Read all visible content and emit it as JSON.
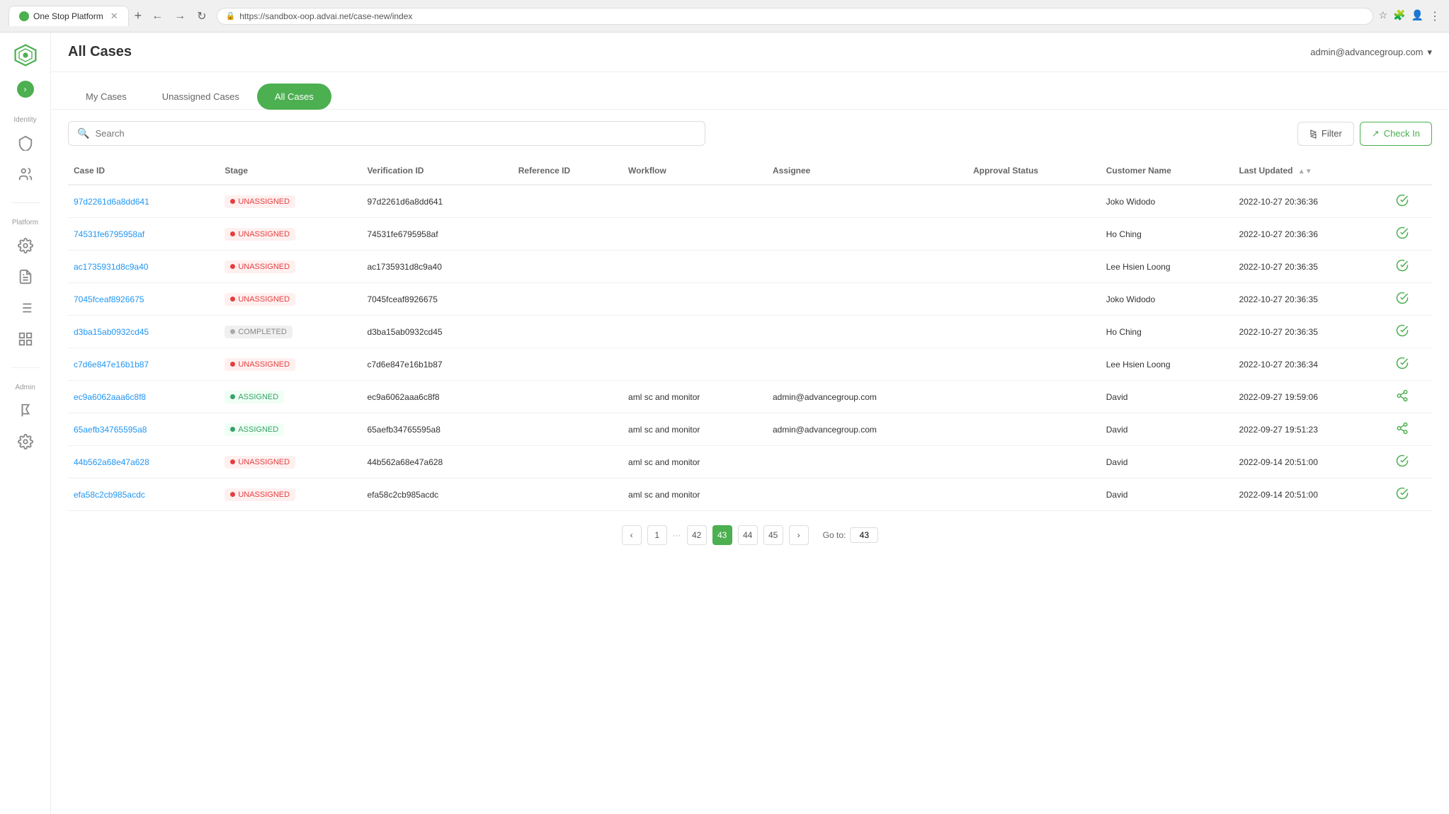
{
  "browser": {
    "tab_title": "One Stop Platform",
    "url": "sandbox-oop.advai.net/case-new/index",
    "url_full": "https://sandbox-oop.advai.net/case-new/index"
  },
  "header": {
    "title": "All Cases",
    "user": "admin@advancegroup.com",
    "user_chevron": "▾"
  },
  "tabs": [
    {
      "id": "my-cases",
      "label": "My Cases",
      "active": false
    },
    {
      "id": "unassigned-cases",
      "label": "Unassigned Cases",
      "active": false
    },
    {
      "id": "all-cases",
      "label": "All Cases",
      "active": true
    }
  ],
  "toolbar": {
    "search_placeholder": "Search",
    "filter_label": "Filter",
    "checkin_label": "Check In"
  },
  "table": {
    "columns": [
      {
        "id": "case-id",
        "label": "Case ID"
      },
      {
        "id": "stage",
        "label": "Stage"
      },
      {
        "id": "verification-id",
        "label": "Verification ID"
      },
      {
        "id": "reference-id",
        "label": "Reference ID"
      },
      {
        "id": "workflow",
        "label": "Workflow"
      },
      {
        "id": "assignee",
        "label": "Assignee"
      },
      {
        "id": "approval-status",
        "label": "Approval Status"
      },
      {
        "id": "customer-name",
        "label": "Customer Name"
      },
      {
        "id": "last-updated",
        "label": "Last Updated",
        "sortable": true
      }
    ],
    "rows": [
      {
        "case_id": "97d2261d6a8dd641",
        "stage": "UNASSIGNED",
        "stage_type": "unassigned",
        "verification_id": "97d2261d6a8dd641",
        "reference_id": "",
        "workflow": "",
        "assignee": "",
        "approval_status": "",
        "customer_name": "Joko Widodo",
        "last_updated": "2022-10-27 20:36:36",
        "icon": "check-circle"
      },
      {
        "case_id": "74531fe6795958af",
        "stage": "UNASSIGNED",
        "stage_type": "unassigned",
        "verification_id": "74531fe6795958af",
        "reference_id": "",
        "workflow": "",
        "assignee": "",
        "approval_status": "",
        "customer_name": "Ho Ching",
        "last_updated": "2022-10-27 20:36:36",
        "icon": "check-circle"
      },
      {
        "case_id": "ac1735931d8c9a40",
        "stage": "UNASSIGNED",
        "stage_type": "unassigned",
        "verification_id": "ac1735931d8c9a40",
        "reference_id": "",
        "workflow": "",
        "assignee": "",
        "approval_status": "",
        "customer_name": "Lee Hsien Loong",
        "last_updated": "2022-10-27 20:36:35",
        "icon": "check-circle"
      },
      {
        "case_id": "7045fceaf8926675",
        "stage": "UNASSIGNED",
        "stage_type": "unassigned",
        "verification_id": "7045fceaf8926675",
        "reference_id": "",
        "workflow": "",
        "assignee": "",
        "approval_status": "",
        "customer_name": "Joko Widodo",
        "last_updated": "2022-10-27 20:36:35",
        "icon": "check-circle"
      },
      {
        "case_id": "d3ba15ab0932cd45",
        "stage": "COMPLETED",
        "stage_type": "completed",
        "verification_id": "d3ba15ab0932cd45",
        "reference_id": "",
        "workflow": "",
        "assignee": "",
        "approval_status": "",
        "customer_name": "Ho Ching",
        "last_updated": "2022-10-27 20:36:35",
        "icon": "check-circle"
      },
      {
        "case_id": "c7d6e847e16b1b87",
        "stage": "UNASSIGNED",
        "stage_type": "unassigned",
        "verification_id": "c7d6e847e16b1b87",
        "reference_id": "",
        "workflow": "",
        "assignee": "",
        "approval_status": "",
        "customer_name": "Lee Hsien Loong",
        "last_updated": "2022-10-27 20:36:34",
        "icon": "check-circle"
      },
      {
        "case_id": "ec9a6062aaa6c8f8",
        "stage": "ASSIGNED",
        "stage_type": "assigned",
        "verification_id": "ec9a6062aaa6c8f8",
        "reference_id": "",
        "workflow": "aml sc and monitor",
        "assignee": "admin@advancegroup.com",
        "approval_status": "",
        "customer_name": "David",
        "last_updated": "2022-09-27 19:59:06",
        "icon": "share"
      },
      {
        "case_id": "65aefb34765595a8",
        "stage": "ASSIGNED",
        "stage_type": "assigned",
        "verification_id": "65aefb34765595a8",
        "reference_id": "",
        "workflow": "aml sc and monitor",
        "assignee": "admin@advancegroup.com",
        "approval_status": "",
        "customer_name": "David",
        "last_updated": "2022-09-27 19:51:23",
        "icon": "share"
      },
      {
        "case_id": "44b562a68e47a628",
        "stage": "UNASSIGNED",
        "stage_type": "unassigned",
        "verification_id": "44b562a68e47a628",
        "reference_id": "",
        "workflow": "aml sc and monitor",
        "assignee": "",
        "approval_status": "",
        "customer_name": "David",
        "last_updated": "2022-09-14 20:51:00",
        "icon": "check-circle"
      },
      {
        "case_id": "efa58c2cb985acdc",
        "stage": "UNASSIGNED",
        "stage_type": "unassigned",
        "verification_id": "efa58c2cb985acdc",
        "reference_id": "",
        "workflow": "aml sc and monitor",
        "assignee": "",
        "approval_status": "",
        "customer_name": "David",
        "last_updated": "2022-09-14 20:51:00",
        "icon": "check-circle"
      }
    ]
  },
  "pagination": {
    "pages": [
      "1",
      "...",
      "42",
      "43",
      "44",
      "45"
    ],
    "active_page": "43",
    "goto_label": "Go to:",
    "goto_value": "43"
  },
  "sidebar": {
    "logo_title": "One Stop Platform",
    "sections": [
      {
        "label": "Identity",
        "items": [
          {
            "id": "shield",
            "icon": "🛡"
          },
          {
            "id": "users",
            "icon": "👥"
          }
        ]
      },
      {
        "label": "Platform",
        "items": [
          {
            "id": "settings",
            "icon": "⚙"
          },
          {
            "id": "list",
            "icon": "📋"
          },
          {
            "id": "menu",
            "icon": "☰"
          },
          {
            "id": "grid",
            "icon": "⊞"
          }
        ]
      },
      {
        "label": "Admin",
        "items": [
          {
            "id": "flag",
            "icon": "🚩"
          },
          {
            "id": "cog",
            "icon": "⚙"
          }
        ]
      }
    ]
  }
}
